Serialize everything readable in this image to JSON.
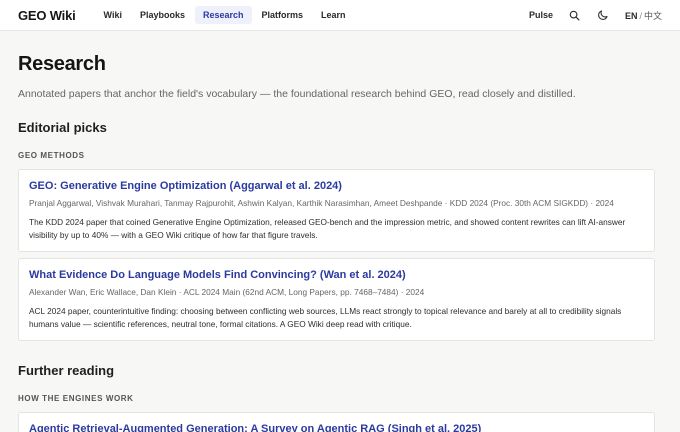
{
  "nav": {
    "logo": "GEO Wiki",
    "items": [
      {
        "label": "Wiki",
        "active": false
      },
      {
        "label": "Playbooks",
        "active": false
      },
      {
        "label": "Research",
        "active": true
      },
      {
        "label": "Platforms",
        "active": false
      },
      {
        "label": "Learn",
        "active": false
      }
    ],
    "pulse": "Pulse",
    "lang_current": "EN",
    "lang_sep": "/",
    "lang_alt": "中文",
    "icons": [
      "search-icon",
      "moon-icon"
    ]
  },
  "page": {
    "title": "Research",
    "intro": "Annotated papers that anchor the field's vocabulary — the foundational research behind GEO, read closely and distilled."
  },
  "editorial": {
    "heading": "Editorial picks",
    "subhead": "GEO METHODS",
    "papers": [
      {
        "title": "GEO: Generative Engine Optimization (Aggarwal et al. 2024)",
        "meta": "Pranjal Aggarwal, Vishvak Murahari, Tanmay Rajpurohit, Ashwin Kalyan, Karthik Narasimhan, Ameet Deshpande · KDD 2024 (Proc. 30th ACM SIGKDD) · 2024",
        "desc": "The KDD 2024 paper that coined Generative Engine Optimization, released GEO-bench and the impression metric, and showed content rewrites can lift AI-answer visibility by up to 40% — with a GEO Wiki critique of how far that figure travels."
      },
      {
        "title": "What Evidence Do Language Models Find Convincing? (Wan et al. 2024)",
        "meta": "Alexander Wan, Eric Wallace, Dan Klein · ACL 2024 Main (62nd ACM, Long Papers, pp. 7468–7484) · 2024",
        "desc": "ACL 2024 paper, counterintuitive finding: choosing between conflicting web sources, LLMs react strongly to topical relevance and barely at all to credibility signals humans value — scientific references, neutral tone, formal citations. A GEO Wiki deep read with critique."
      }
    ]
  },
  "further": {
    "heading": "Further reading",
    "subhead": "HOW THE ENGINES WORK",
    "papers": [
      {
        "title": "Agentic Retrieval-Augmented Generation: A Survey on Agentic RAG (Singh et al. 2025)"
      }
    ]
  },
  "colors": {
    "accent": "#2b3a9e",
    "active_bg": "#eef0fb",
    "page_bg": "#f7f7f6",
    "card_bg": "#ffffff"
  }
}
